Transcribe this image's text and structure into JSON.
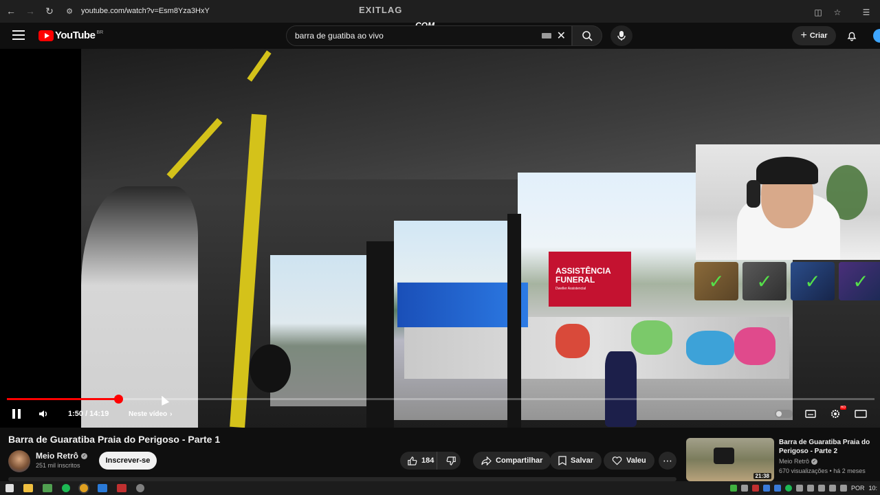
{
  "browser": {
    "url": "youtube.com/watch?v=Esm8Yza3HxY",
    "watermark_text": "EXITLAG"
  },
  "header": {
    "logo_text": "YouTube",
    "logo_country": "BR",
    "search_value": "barra de guatiba ao vivo",
    "overlay_text": "COM",
    "create_label": "Criar"
  },
  "video": {
    "billboard_line1": "ASSISTÊNCIA",
    "billboard_line2": "FUNERAL",
    "billboard_small": "Dweller Assistencial",
    "current_time": "1:50",
    "duration": "14:19",
    "time_display": "1:50 / 14:19",
    "chapter_label": "Neste vídeo",
    "progress_fraction": 0.128
  },
  "info": {
    "title": "Barra de Guaratiba Praia do Perigoso - Parte 1",
    "channel_name": "Meio Retrô",
    "subscribers": "251 mil inscritos",
    "subscribe_label": "Inscrever-se",
    "like_count": "184",
    "share_label": "Compartilhar",
    "save_label": "Salvar",
    "thanks_label": "Valeu"
  },
  "recommendation": {
    "title": "Barra de Guaratiba Praia do Perigoso - Parte 2",
    "channel": "Meio Retrô",
    "meta": "670 visualizações • há 2 meses",
    "duration": "21:38"
  },
  "taskbar": {
    "language": "POR",
    "clock": "10:"
  },
  "colors": {
    "accent_red": "#ff0000",
    "background": "#0f0f0f",
    "rank_check": "#55e04a"
  }
}
